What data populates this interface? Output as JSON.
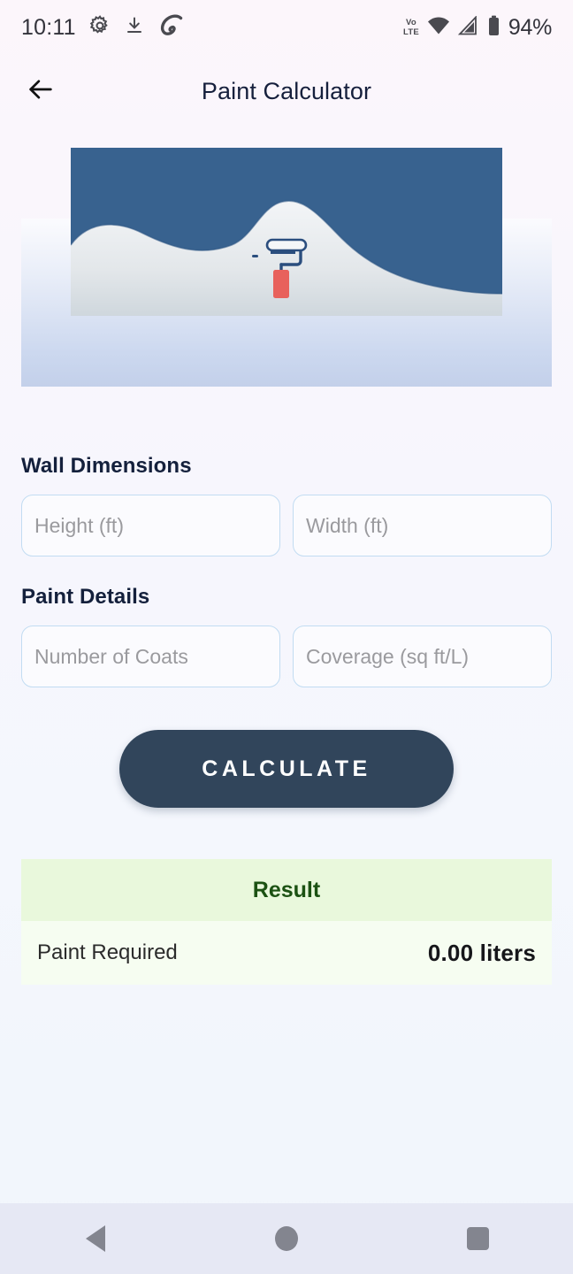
{
  "status_bar": {
    "time": "10:11",
    "icons_left": [
      "gear-icon",
      "download-icon",
      "carrier-logo-icon"
    ],
    "network_line1": "Vo",
    "network_line2": "LTE",
    "icons_right": [
      "wifi-icon",
      "signal-icon",
      "battery-icon"
    ],
    "battery_percent": "94%"
  },
  "appbar": {
    "back_icon": "back-arrow-icon",
    "title": "Paint Calculator"
  },
  "hero": {
    "alt": "paint-roller-illustration",
    "wall_color": "#38628f",
    "paint_color": "#e6eaee",
    "roller_handle_color": "#e8615c",
    "roller_frame_color": "#2b4e7e"
  },
  "sections": {
    "wall_dimensions": {
      "title": "Wall Dimensions",
      "fields": [
        {
          "name": "height-input",
          "placeholder": "Height (ft)",
          "value": ""
        },
        {
          "name": "width-input",
          "placeholder": "Width (ft)",
          "value": ""
        }
      ]
    },
    "paint_details": {
      "title": "Paint Details",
      "fields": [
        {
          "name": "coats-input",
          "placeholder": "Number of Coats",
          "value": ""
        },
        {
          "name": "coverage-input",
          "placeholder": "Coverage (sq ft/L)",
          "value": ""
        }
      ]
    }
  },
  "actions": {
    "calculate_label": "CALCULATE",
    "calculate_bg": "#31455b"
  },
  "result": {
    "header": "Result",
    "header_bg": "#e9f8dc",
    "header_color": "#1c5213",
    "rows": [
      {
        "label": "Paint Required",
        "value": "0.00 liters"
      }
    ]
  },
  "nav_bar": {
    "back": "back-triangle-icon",
    "home": "home-circle-icon",
    "recents": "recents-square-icon"
  }
}
